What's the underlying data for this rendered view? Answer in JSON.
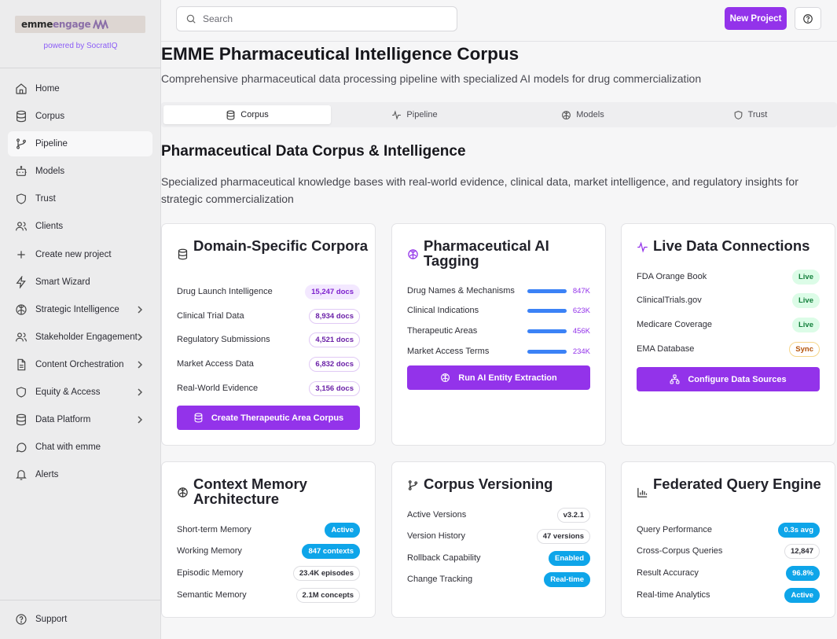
{
  "brand": {
    "logo_part1": "emme",
    "logo_part2": "engage",
    "powered_by": "powered by SocratIQ"
  },
  "sidebar": {
    "items": [
      {
        "label": "Home",
        "icon": "home-icon"
      },
      {
        "label": "Corpus",
        "icon": "database-icon"
      },
      {
        "label": "Pipeline",
        "icon": "git-branch-icon",
        "active": true
      },
      {
        "label": "Models",
        "icon": "bot-icon"
      },
      {
        "label": "Trust",
        "icon": "shield-icon"
      },
      {
        "label": "Clients",
        "icon": "users-icon"
      },
      {
        "label": "Create new project",
        "icon": "plus-icon"
      },
      {
        "label": "Smart Wizard",
        "icon": "zap-icon"
      },
      {
        "label": "Strategic Intelligence",
        "icon": "brain-icon",
        "expandable": true
      },
      {
        "label": "Stakeholder Engagement",
        "icon": "users-icon",
        "expandable": true
      },
      {
        "label": "Content Orchestration",
        "icon": "file-icon",
        "expandable": true
      },
      {
        "label": "Equity & Access",
        "icon": "shield-icon",
        "expandable": true
      },
      {
        "label": "Data Platform",
        "icon": "database-icon",
        "expandable": true
      },
      {
        "label": "Chat with emme",
        "icon": "chat-icon"
      },
      {
        "label": "Alerts",
        "icon": "bell-icon"
      }
    ],
    "support_label": "Support"
  },
  "header": {
    "search_placeholder": "Search",
    "new_project_label": "New Project"
  },
  "page": {
    "title": "EMME Pharmaceutical Intelligence Corpus",
    "subtitle": "Comprehensive pharmaceutical data processing pipeline with specialized AI models for drug commercialization"
  },
  "tabs": [
    {
      "label": "Corpus",
      "icon": "database-icon",
      "active": true
    },
    {
      "label": "Pipeline",
      "icon": "activity-icon"
    },
    {
      "label": "Models",
      "icon": "brain-icon"
    },
    {
      "label": "Trust",
      "icon": "shield-icon"
    }
  ],
  "section": {
    "title": "Pharmaceutical Data Corpus & Intelligence",
    "description": "Specialized pharmaceutical knowledge bases with real-world evidence, clinical data, market intelligence, and regulatory insights for strategic commercialization"
  },
  "cards": {
    "domain": {
      "title": "Domain-Specific Corpora",
      "rows": [
        {
          "label": "Drug Launch Intelligence",
          "value": "15,247 docs"
        },
        {
          "label": "Clinical Trial Data",
          "value": "8,934 docs"
        },
        {
          "label": "Regulatory Submissions",
          "value": "4,521 docs"
        },
        {
          "label": "Market Access Data",
          "value": "6,832 docs"
        },
        {
          "label": "Real-World Evidence",
          "value": "3,156 docs"
        }
      ],
      "button": "Create Therapeutic Area Corpus"
    },
    "tagging": {
      "title": "Pharmaceutical AI Tagging",
      "rows": [
        {
          "label": "Drug Names & Mechanisms",
          "value": "847K"
        },
        {
          "label": "Clinical Indications",
          "value": "623K"
        },
        {
          "label": "Therapeutic Areas",
          "value": "456K"
        },
        {
          "label": "Market Access Terms",
          "value": "234K"
        }
      ],
      "button": "Run AI Entity Extraction"
    },
    "live": {
      "title": "Live Data Connections",
      "rows": [
        {
          "label": "FDA Orange Book",
          "value": "Live"
        },
        {
          "label": "ClinicalTrials.gov",
          "value": "Live"
        },
        {
          "label": "Medicare Coverage",
          "value": "Live"
        },
        {
          "label": "EMA Database",
          "value": "Sync"
        }
      ],
      "button": "Configure Data Sources"
    },
    "memory": {
      "title": "Context Memory Architecture",
      "rows": [
        {
          "label": "Short-term Memory",
          "value": "Active"
        },
        {
          "label": "Working Memory",
          "value": "847 contexts"
        },
        {
          "label": "Episodic Memory",
          "value": "23.4K episodes"
        },
        {
          "label": "Semantic Memory",
          "value": "2.1M concepts"
        }
      ]
    },
    "versioning": {
      "title": "Corpus Versioning",
      "rows": [
        {
          "label": "Active Versions",
          "value": "v3.2.1"
        },
        {
          "label": "Version History",
          "value": "47 versions"
        },
        {
          "label": "Rollback Capability",
          "value": "Enabled"
        },
        {
          "label": "Change Tracking",
          "value": "Real-time"
        }
      ]
    },
    "federated": {
      "title": "Federated Query Engine",
      "rows": [
        {
          "label": "Query Performance",
          "value": "0.3s avg"
        },
        {
          "label": "Cross-Corpus Queries",
          "value": "12,847"
        },
        {
          "label": "Result Accuracy",
          "value": "96.8%"
        },
        {
          "label": "Real-time Analytics",
          "value": "Active"
        }
      ]
    }
  },
  "colors": {
    "accent": "#9333ea",
    "bar": "#3b82f6",
    "cyan": "#0ea5e9"
  }
}
